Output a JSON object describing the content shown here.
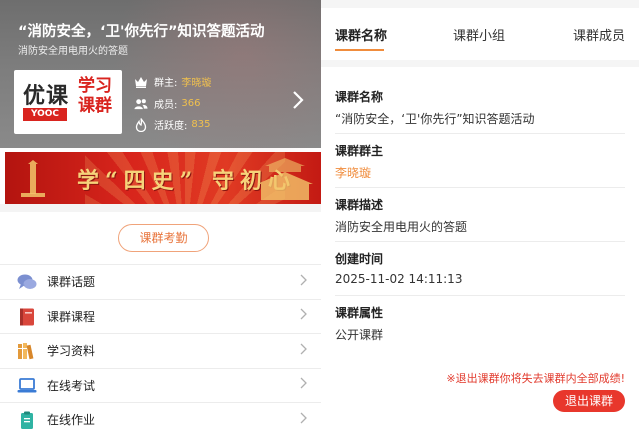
{
  "group": {
    "title": "“消防安全，‘卫'你先行”知识答题活动",
    "description": "消防安全用电用火的答题",
    "logo": {
      "brand_cn": "优课",
      "brand_en": "YOOC",
      "tagline": "学习课群"
    },
    "owner_label": "群主:",
    "owner_value": "李晓璇",
    "members_label": "成员:",
    "members_value": "366",
    "activity_label": "活跃度:",
    "activity_value": "835",
    "icons": {
      "owner": "crown-icon",
      "members": "people-icon",
      "activity": "flame-icon",
      "more": "chevron-right-icon"
    }
  },
  "banner": {
    "text": "学“四史” 守初心"
  },
  "attendance_button": "课群考勤",
  "menu": [
    {
      "label": "课群话题",
      "icon": "chat-bubbles-icon",
      "color": "#7b8fd0"
    },
    {
      "label": "课群课程",
      "icon": "book-icon",
      "color": "#d9463b"
    },
    {
      "label": "学习资料",
      "icon": "books-shelf-icon",
      "color": "#e39a3b"
    },
    {
      "label": "在线考试",
      "icon": "laptop-icon",
      "color": "#3a7bd5"
    },
    {
      "label": "在线作业",
      "icon": "clipboard-icon",
      "color": "#2fb3a3"
    }
  ],
  "tabs": [
    {
      "label": "课群名称",
      "active": true
    },
    {
      "label": "课群小组",
      "active": false
    },
    {
      "label": "课群成员",
      "active": false
    }
  ],
  "info": [
    {
      "label": "课群名称",
      "value": "“消防安全，‘卫'你先行”知识答题活动"
    },
    {
      "label": "课群群主",
      "value": "李晓璇"
    },
    {
      "label": "课群描述",
      "value": "消防安全用电用火的答题"
    },
    {
      "label": "创建时间",
      "value": "2025-11-02 14:11:13"
    },
    {
      "label": "课群属性",
      "value": "公开课群"
    }
  ],
  "warning": "※退出课群你将失去课群内全部成绩!",
  "quit_button": "退出课群",
  "colors": {
    "accent": "#f08c3c",
    "danger": "#e8372c",
    "highlight": "#f0c04e"
  }
}
